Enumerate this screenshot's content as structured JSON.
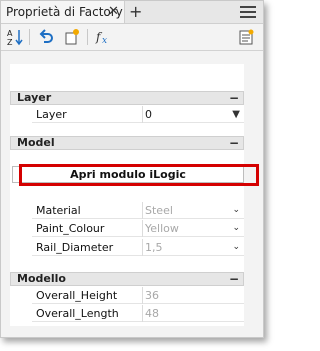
{
  "tab": {
    "title": "Proprietà di Factory",
    "close_glyph": "✕",
    "add_glyph": "+"
  },
  "toolbar": {
    "sort_icon": "sort-az-icon",
    "undo_icon": "undo-icon",
    "new_icon": "new-item-icon",
    "formula_icon": "fx-icon",
    "properties_icon": "properties-icon"
  },
  "sections": {
    "layer": {
      "title": "Layer",
      "collapse": "−",
      "rows": [
        {
          "label": "Layer",
          "value": "0",
          "disabled": false,
          "dropdown": true
        }
      ]
    },
    "model": {
      "title": "Model",
      "collapse": "−",
      "button_label": "Apri modulo iLogic",
      "rows": [
        {
          "label": "Material",
          "value": "Steel",
          "disabled": true,
          "dropdown": true
        },
        {
          "label": "Paint_Colour",
          "value": "Yellow",
          "disabled": true,
          "dropdown": true
        },
        {
          "label": "Rail_Diameter",
          "value": "1,5",
          "disabled": true,
          "dropdown": true
        }
      ]
    },
    "modello": {
      "title": "Modello",
      "collapse": "−",
      "rows": [
        {
          "label": "Overall_Height",
          "value": "36",
          "disabled": true,
          "dropdown": false
        },
        {
          "label": "Overall_Length",
          "value": "48",
          "disabled": true,
          "dropdown": false
        }
      ]
    }
  },
  "colors": {
    "highlight": "#d40000",
    "undo_blue": "#1e6fc4",
    "disabled_text": "#a8a8a8"
  }
}
